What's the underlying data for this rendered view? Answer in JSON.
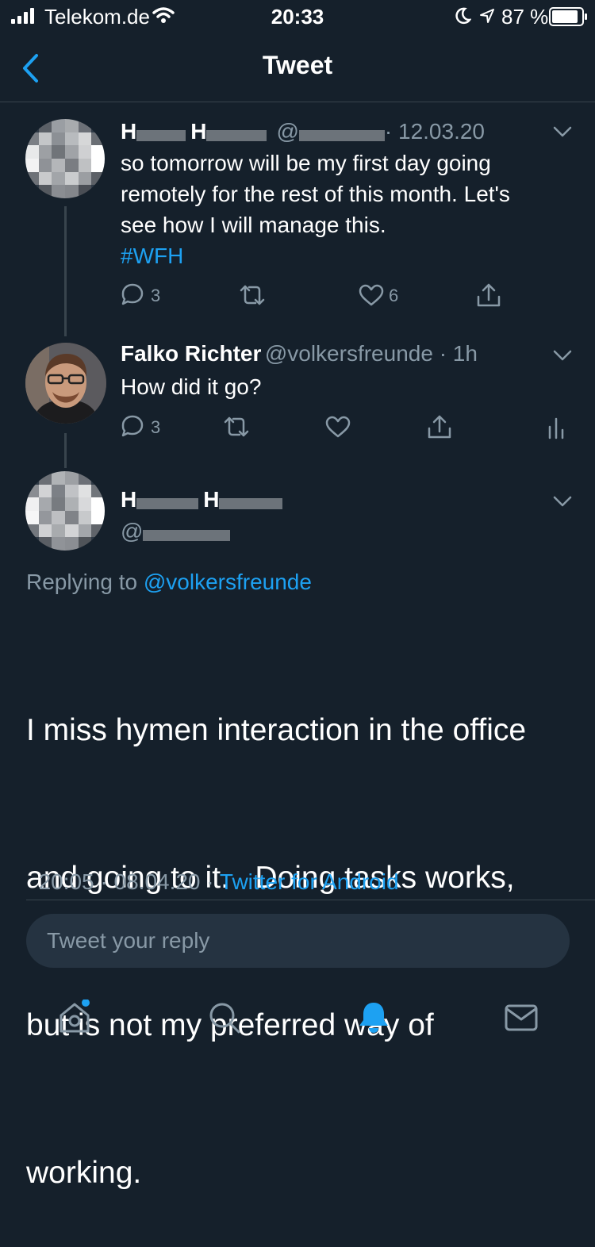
{
  "status_bar": {
    "carrier": "Telekom.de",
    "time": "20:33",
    "battery": "87 %"
  },
  "header": {
    "title": "Tweet"
  },
  "tweets": [
    {
      "name": "H",
      "name2": "H",
      "handle_prefix": "@",
      "date": "· 12.03.20",
      "text_lines": [
        "so tomorrow will be my first day going",
        "remotely for the rest of this month. Let's",
        "see how I will manage this."
      ],
      "hashtag": "#WFH",
      "replies": "3",
      "likes": "6"
    },
    {
      "name": "Falko Richter",
      "handle": "@volkersfreunde · 1h",
      "text": "How did it go?",
      "replies": "3"
    }
  ],
  "main_tweet": {
    "name": "H",
    "name2": "H",
    "handle_prefix": "@",
    "replying_prefix": "Replying to ",
    "replying_handle": "@volkersfreunde",
    "text_lines": [
      "I miss hymen interaction in the office",
      "and going to it.   Doing tasks works,",
      "but is not my preferred way of",
      "working."
    ],
    "meta_time": "20:05 · 08.04.20 · ",
    "source": "Twitter for Android"
  },
  "reply": {
    "placeholder": "Tweet your reply"
  },
  "tabs": [
    "home-icon",
    "search-icon",
    "notifications-icon",
    "messages-icon"
  ],
  "colors": {
    "background": "#15202b",
    "accent": "#1da1f2",
    "muted": "#8899a6"
  }
}
